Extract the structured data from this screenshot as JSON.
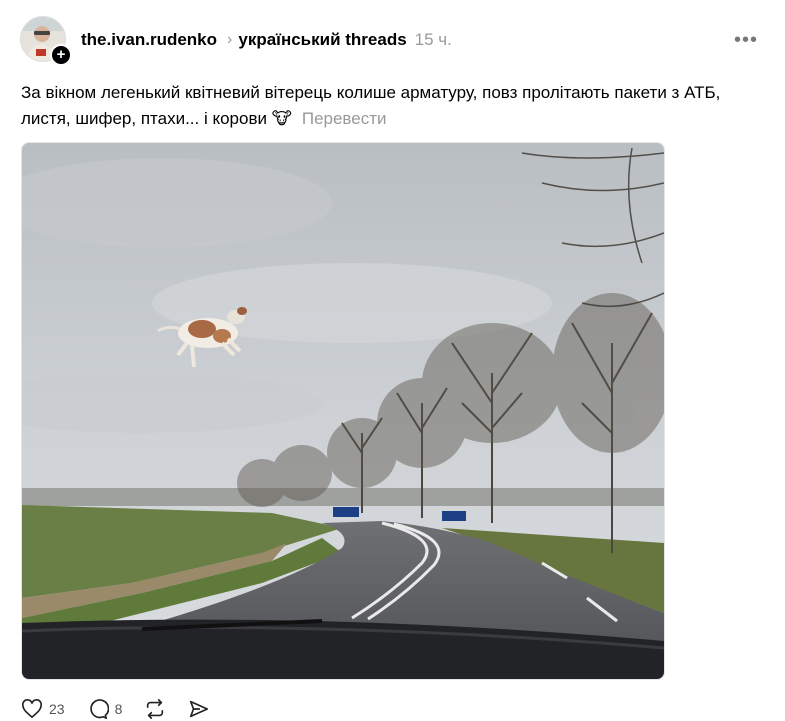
{
  "post": {
    "username": "the.ivan.rudenko",
    "topic": "український threads",
    "time": "15 ч.",
    "text": "За вікном легенький квітневий вітерець колише арматуру, повз пролітають пакети з АТБ, листя, шифер, птахи... і корови 🐮",
    "translate_label": "Перевести",
    "image_alt": "Flying cow over a countryside road",
    "likes": "23",
    "replies": "8"
  },
  "icons": {
    "follow": "plus-icon",
    "more": "more-dots-icon",
    "like": "heart-icon",
    "reply": "reply-bubble-icon",
    "repost": "repost-icon",
    "share": "share-send-icon"
  }
}
